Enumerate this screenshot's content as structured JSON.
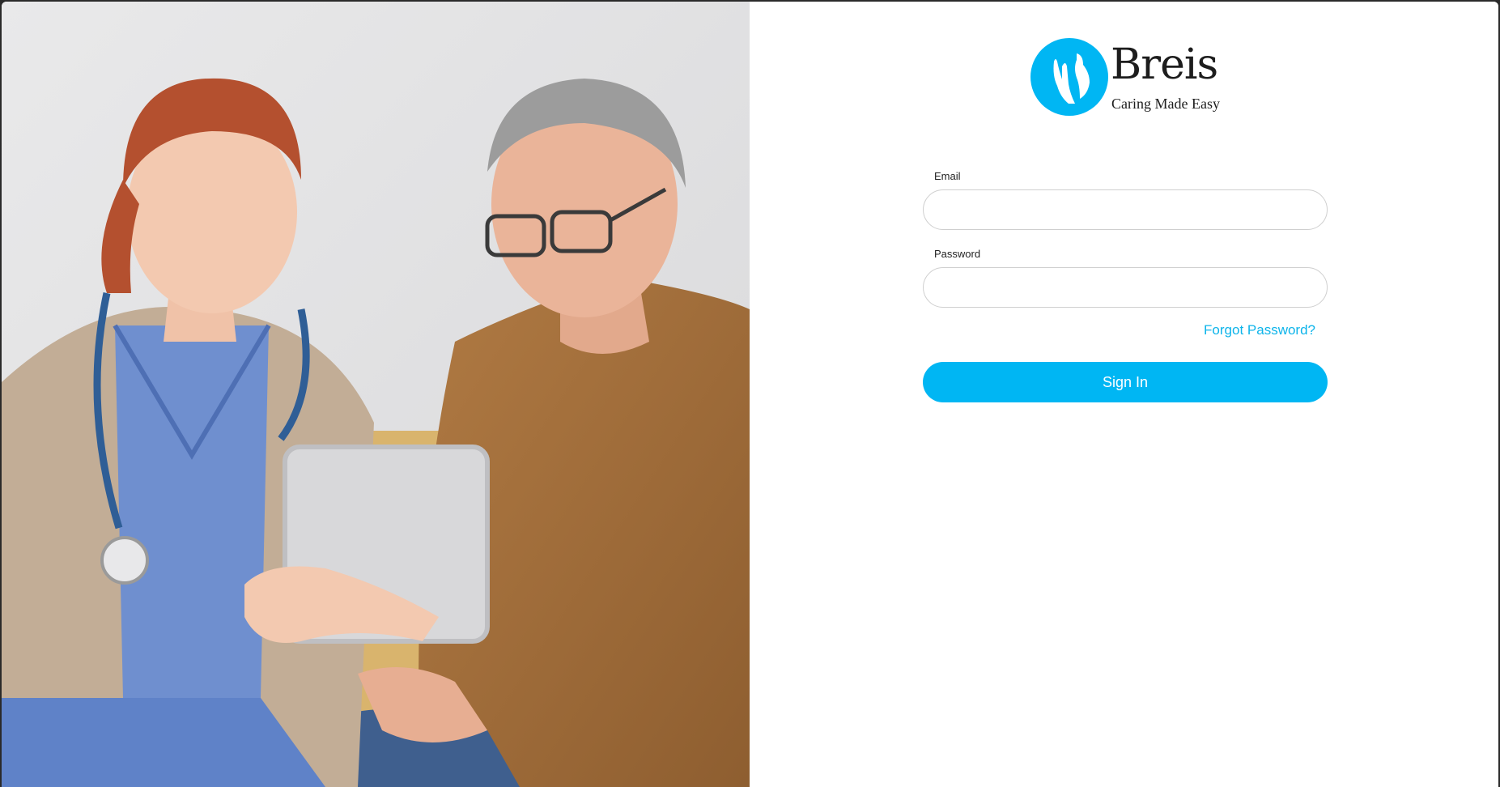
{
  "brand": {
    "name": "Breis",
    "tagline": "Caring Made Easy",
    "logo_icon": "caring-hands-icon",
    "accent_color": "#00b6f3"
  },
  "hero_image": {
    "icon": "caregiver-photo"
  },
  "form": {
    "email_label": "Email",
    "email_value": "",
    "password_label": "Password",
    "password_value": "",
    "forgot_label": "Forgot Password?",
    "submit_label": "Sign In"
  }
}
